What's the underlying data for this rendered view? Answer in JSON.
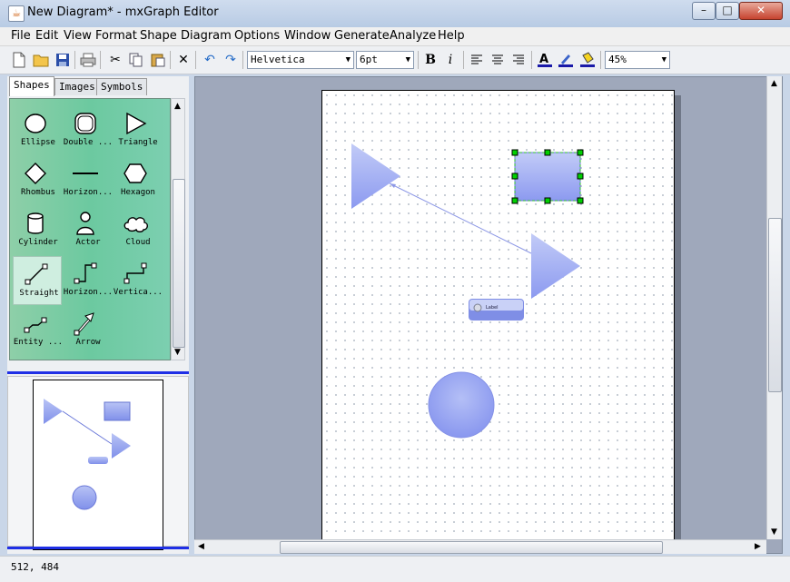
{
  "window": {
    "title": "New Diagram* - mxGraph Editor",
    "min": "–",
    "max": "□",
    "close": "✕"
  },
  "menu": [
    "File",
    "Edit",
    "View",
    "Format",
    "Shape",
    "Diagram",
    "Options",
    "Window",
    "Generate",
    "Analyze",
    "Help"
  ],
  "toolbar": {
    "font": "Helvetica",
    "size": "6pt",
    "bold": "B",
    "italic": "i",
    "zoom": "45%"
  },
  "tabs": [
    "Shapes",
    "Images",
    "Symbols"
  ],
  "palette": [
    "Ellipse",
    "Double ...",
    "Triangle",
    "Rhombus",
    "Horizon...",
    "Hexagon",
    "Cylinder",
    "Actor",
    "Cloud",
    "Straight",
    "Horizon...",
    "Vertica...",
    "Entity ...",
    "Arrow"
  ],
  "canvas": {
    "label_text": "Label"
  },
  "status": {
    "coords": "512, 484"
  },
  "colors": {
    "shape_fill": "#96a5ee",
    "selection_handle": "#00d000",
    "accent_sep": "#1f2fe6"
  }
}
